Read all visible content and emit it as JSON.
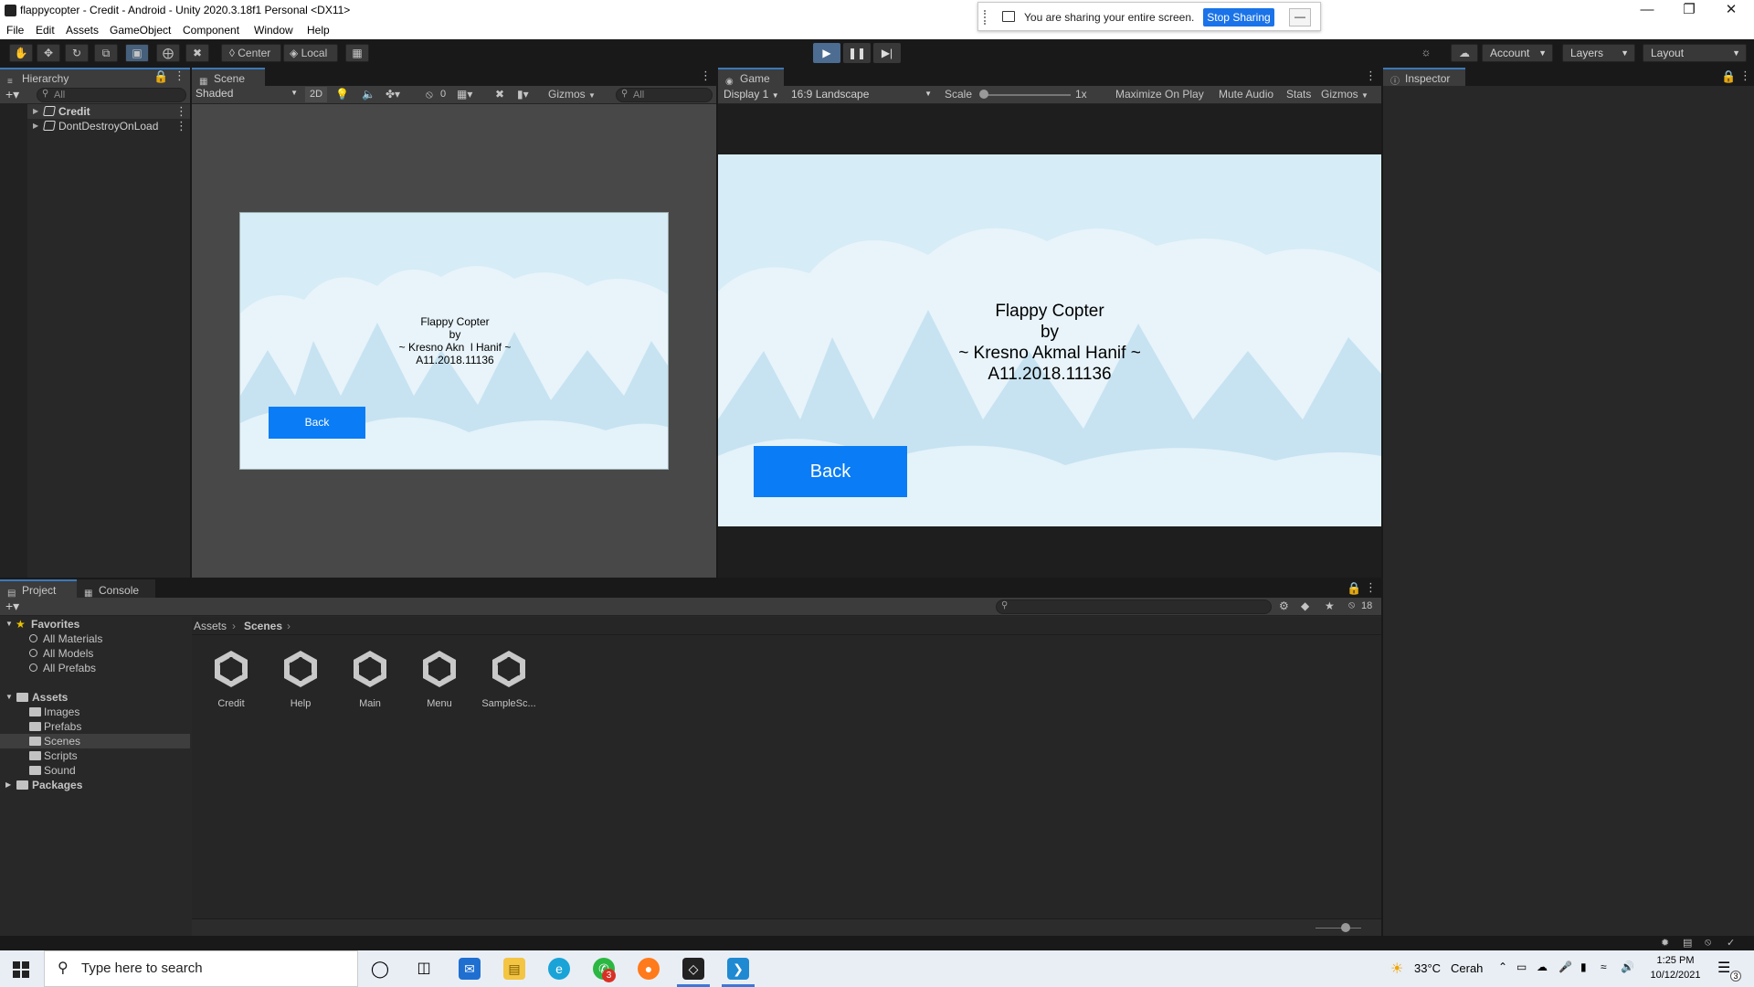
{
  "window": {
    "title": "flappycopter - Credit - Android - Unity 2020.3.18f1 Personal <DX11>"
  },
  "sharing": {
    "message": "You are sharing your entire screen.",
    "stop_label": "Stop Sharing",
    "hide_label": "—"
  },
  "menu": [
    "File",
    "Edit",
    "Assets",
    "GameObject",
    "Component",
    "Window",
    "Help"
  ],
  "toolbar": {
    "pivot_label": "Center",
    "space_label": "Local",
    "account_label": "Account",
    "layers_label": "Layers",
    "layout_label": "Layout"
  },
  "hierarchy": {
    "tab_label": "Hierarchy",
    "search_placeholder": "All",
    "items": [
      "Credit",
      "DontDestroyOnLoad"
    ]
  },
  "scene": {
    "tab_label": "Scene",
    "shading": "Shaded",
    "mode_2d": "2D",
    "hidden_count": "0",
    "gizmos_label": "Gizmos",
    "search_placeholder": "All",
    "credit_lines": [
      "Flappy Copter",
      "by",
      "~ Kresno Akn  l Hanif ~",
      "A11.2018.11136"
    ],
    "back_label": "Back"
  },
  "game": {
    "tab_label": "Game",
    "display": "Display 1",
    "aspect": "16:9 Landscape",
    "scale_label": "Scale",
    "scale_value": "1x",
    "toggles": [
      "Maximize On Play",
      "Mute Audio",
      "Stats",
      "Gizmos"
    ],
    "credit_lines": [
      "Flappy Copter",
      "by",
      "~ Kresno Akmal Hanif ~",
      "A11.2018.11136"
    ],
    "back_label": "Back"
  },
  "inspector": {
    "tab_label": "Inspector"
  },
  "project": {
    "tab_label": "Project",
    "console_label": "Console",
    "hidden_count": "18",
    "favorites_label": "Favorites",
    "favorites": [
      "All Materials",
      "All Models",
      "All Prefabs"
    ],
    "assets_label": "Assets",
    "asset_folders": [
      "Images",
      "Prefabs",
      "Scenes",
      "Scripts",
      "Sound"
    ],
    "packages_label": "Packages",
    "breadcrumb": [
      "Assets",
      "Scenes"
    ],
    "files": [
      "Credit",
      "Help",
      "Main",
      "Menu",
      "SampleSc..."
    ]
  },
  "taskbar": {
    "search_placeholder": "Type here to search",
    "weather_temp": "33°C",
    "weather_text": "Cerah",
    "time": "1:25 PM",
    "date": "10/12/2021",
    "whatsapp_badge": "3",
    "notif_badge": "3"
  },
  "colors": {
    "accent": "#3a79bb",
    "play_active": "#4c6c92",
    "button_blue": "#0a7cf5",
    "sky": "#d6ecf7",
    "panel": "#282828"
  }
}
